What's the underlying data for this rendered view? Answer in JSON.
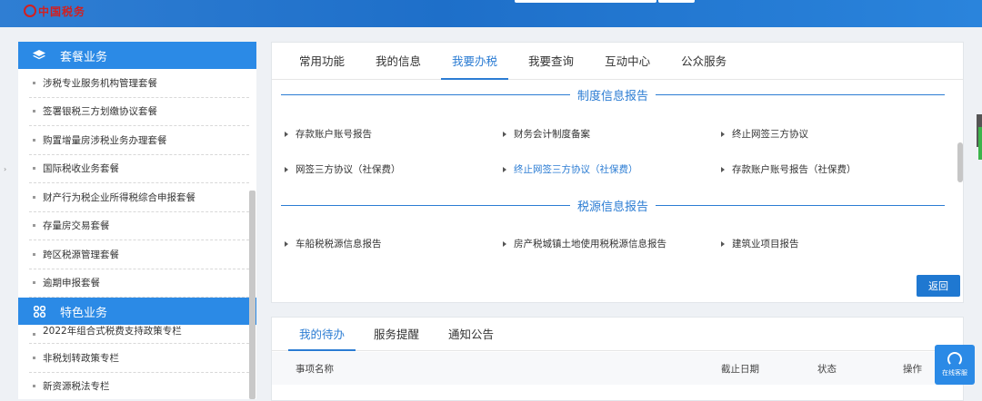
{
  "header": {
    "logo_text": "中国税务"
  },
  "sidebar": {
    "section1_title": "套餐业务",
    "section1_items": [
      "涉税专业服务机构管理套餐",
      "签署银税三方划缴协议套餐",
      "购置增量房涉税业务办理套餐",
      "国际税收业务套餐",
      "财产行为税企业所得税综合申报套餐",
      "存量房交易套餐",
      "跨区税源管理套餐",
      "逾期申报套餐"
    ],
    "section2_title": "特色业务",
    "section2_items": [
      "2022年组合式税费支持政策专栏",
      "非税划转政策专栏",
      "新资源税法专栏"
    ]
  },
  "main": {
    "tabs": [
      "常用功能",
      "我的信息",
      "我要办税",
      "我要查询",
      "互动中心",
      "公众服务"
    ],
    "active_tab": "我要办税",
    "section1_title": "制度信息报告",
    "section1_rows": [
      [
        "存款账户账号报告",
        "财务会计制度备案",
        "终止网签三方协议"
      ],
      [
        "网签三方协议（社保费）",
        "终止网签三方协议（社保费）",
        "存款账户账号报告（社保费）"
      ]
    ],
    "section2_title": "税源信息报告",
    "section2_rows": [
      [
        "车船税税源信息报告",
        "房产税城镇土地使用税税源信息报告",
        "建筑业项目报告"
      ]
    ],
    "back_label": "返回"
  },
  "lower": {
    "tabs": [
      "我的待办",
      "服务提醒",
      "通知公告"
    ],
    "columns": [
      "事项名称",
      "截止日期",
      "状态",
      "操作"
    ]
  },
  "float_service_label": "在线客服"
}
